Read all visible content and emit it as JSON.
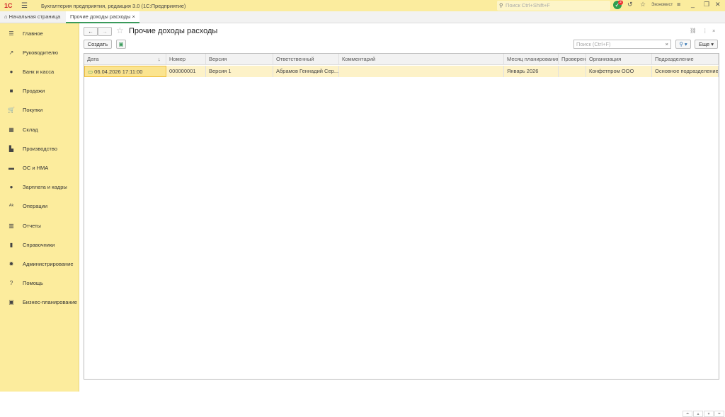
{
  "titlebar": {
    "logo": "1С",
    "title": "Бухгалтерия предприятия, редакция 3.0  (1С:Предприятие)",
    "search_placeholder": "Поиск Ctrl+Shift+F",
    "notifications": "2",
    "user": "Экономист"
  },
  "tabs": [
    {
      "label": "Начальная страница"
    },
    {
      "label": "Прочие доходы расходы"
    }
  ],
  "sidebar": {
    "items": [
      {
        "label": "Главное",
        "icon": "menu-icon"
      },
      {
        "label": "Руководителю",
        "icon": "trend-icon"
      },
      {
        "label": "Банк и касса",
        "icon": "coin-icon"
      },
      {
        "label": "Продажи",
        "icon": "bag-icon"
      },
      {
        "label": "Покупки",
        "icon": "cart-icon"
      },
      {
        "label": "Склад",
        "icon": "grid-icon"
      },
      {
        "label": "Производство",
        "icon": "factory-icon"
      },
      {
        "label": "ОС и НМА",
        "icon": "truck-icon"
      },
      {
        "label": "Зарплата и кадры",
        "icon": "person-icon"
      },
      {
        "label": "Операции",
        "icon": "operations-icon"
      },
      {
        "label": "Отчеты",
        "icon": "chart-icon"
      },
      {
        "label": "Справочники",
        "icon": "book-icon"
      },
      {
        "label": "Администрирование",
        "icon": "gear-icon"
      },
      {
        "label": "Помощь",
        "icon": "question-icon"
      },
      {
        "label": "Бизнес-планирование",
        "icon": "presentation-icon"
      }
    ]
  },
  "form": {
    "title": "Прочие доходы расходы",
    "create_label": "Создать",
    "search_placeholder": "Поиск (Ctrl+F)",
    "more_label": "Еще"
  },
  "table": {
    "columns": [
      "Дата",
      "Номер",
      "Версия",
      "Ответственный",
      "Комментарий",
      "Месяц планирования",
      "Проверен",
      "Организация",
      "Подразделение"
    ],
    "rows": [
      [
        "06.04.2026 17:11:00",
        "000000001",
        "Версия 1",
        "Абрамов Геннадий Сер...",
        "",
        "Январь 2026",
        "",
        "Конфетпром ООО",
        "Основное подразделение"
      ]
    ]
  }
}
